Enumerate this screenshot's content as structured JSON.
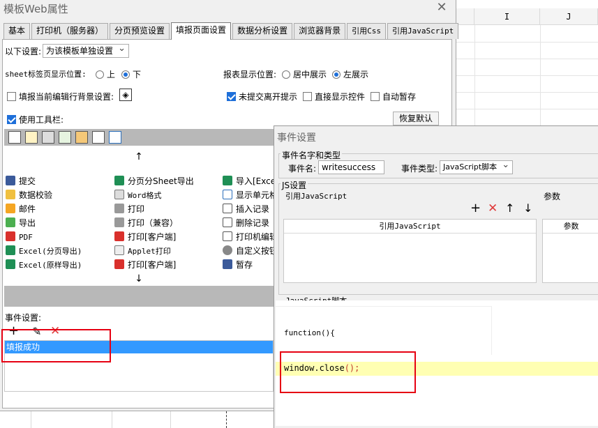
{
  "sheet": {
    "columns": [
      "I",
      "J"
    ]
  },
  "dialog": {
    "title": "模板Web属性",
    "close_glyph": "✕",
    "tabs": [
      "基本",
      "打印机（服务器）",
      "分页预览设置",
      "填报页面设置",
      "数据分析设置",
      "浏览器背景",
      "引用Css",
      "引用JavaScript"
    ],
    "active_tab": 3,
    "settings_label": "以下设置:",
    "settings_value": "为该模板单独设置",
    "sheet_tab_label": "sheet标签页显示位置:",
    "sheet_tab_options": [
      "上",
      "下"
    ],
    "report_pos_label": "报表显示位置:",
    "report_pos_options": [
      "居中展示",
      "左展示"
    ],
    "bg_setting_label": "填报当前编辑行背景设置:",
    "unsubmitted_label": "未提交离开提示",
    "direct_control_label": "直接显示控件",
    "autosave_label": "自动暂存",
    "use_toolbar_label": "使用工具栏:",
    "restore_default_label": "恢复默认",
    "arrow_up": "↑",
    "arrow_down": "↓",
    "items_col1": [
      "提交",
      "数据校验",
      "邮件",
      "导出",
      "PDF",
      "Excel(分页导出)",
      "Excel(原样导出)"
    ],
    "items_col2": [
      "分页分Sheet导出",
      "Word格式",
      "打印",
      "打印（兼容）",
      "打印[客户端]",
      "Applet打印",
      "打印[客户端]"
    ],
    "items_col3": [
      "导入[Excel]",
      "显示单元格",
      "插入记录",
      "删除记录",
      "打印机编辑",
      "自定义按钮",
      "暂存"
    ],
    "event_settings_label": "事件设置:",
    "event_tools": [
      "+",
      "✎",
      "✕"
    ],
    "event_item": "填报成功"
  },
  "event_dialog": {
    "title": "事件设置",
    "name_type_group": "事件名字和类型",
    "event_name_label": "事件名:",
    "event_name_value": "writesuccess",
    "event_type_label": "事件类型:",
    "event_type_value": "JavaScript脚本",
    "js_group": "JS设置",
    "ref_js_label": "引用JavaScript",
    "params_label": "参数",
    "ref_tools": [
      "+",
      "✕",
      "↑",
      "↓"
    ],
    "ref_js_header": "引用JavaScript",
    "params_header": "参数",
    "script_label": "JavaScript脚本",
    "code_line1": "function(){",
    "code_line2_a": "window.close",
    "code_line2_b": "();"
  }
}
